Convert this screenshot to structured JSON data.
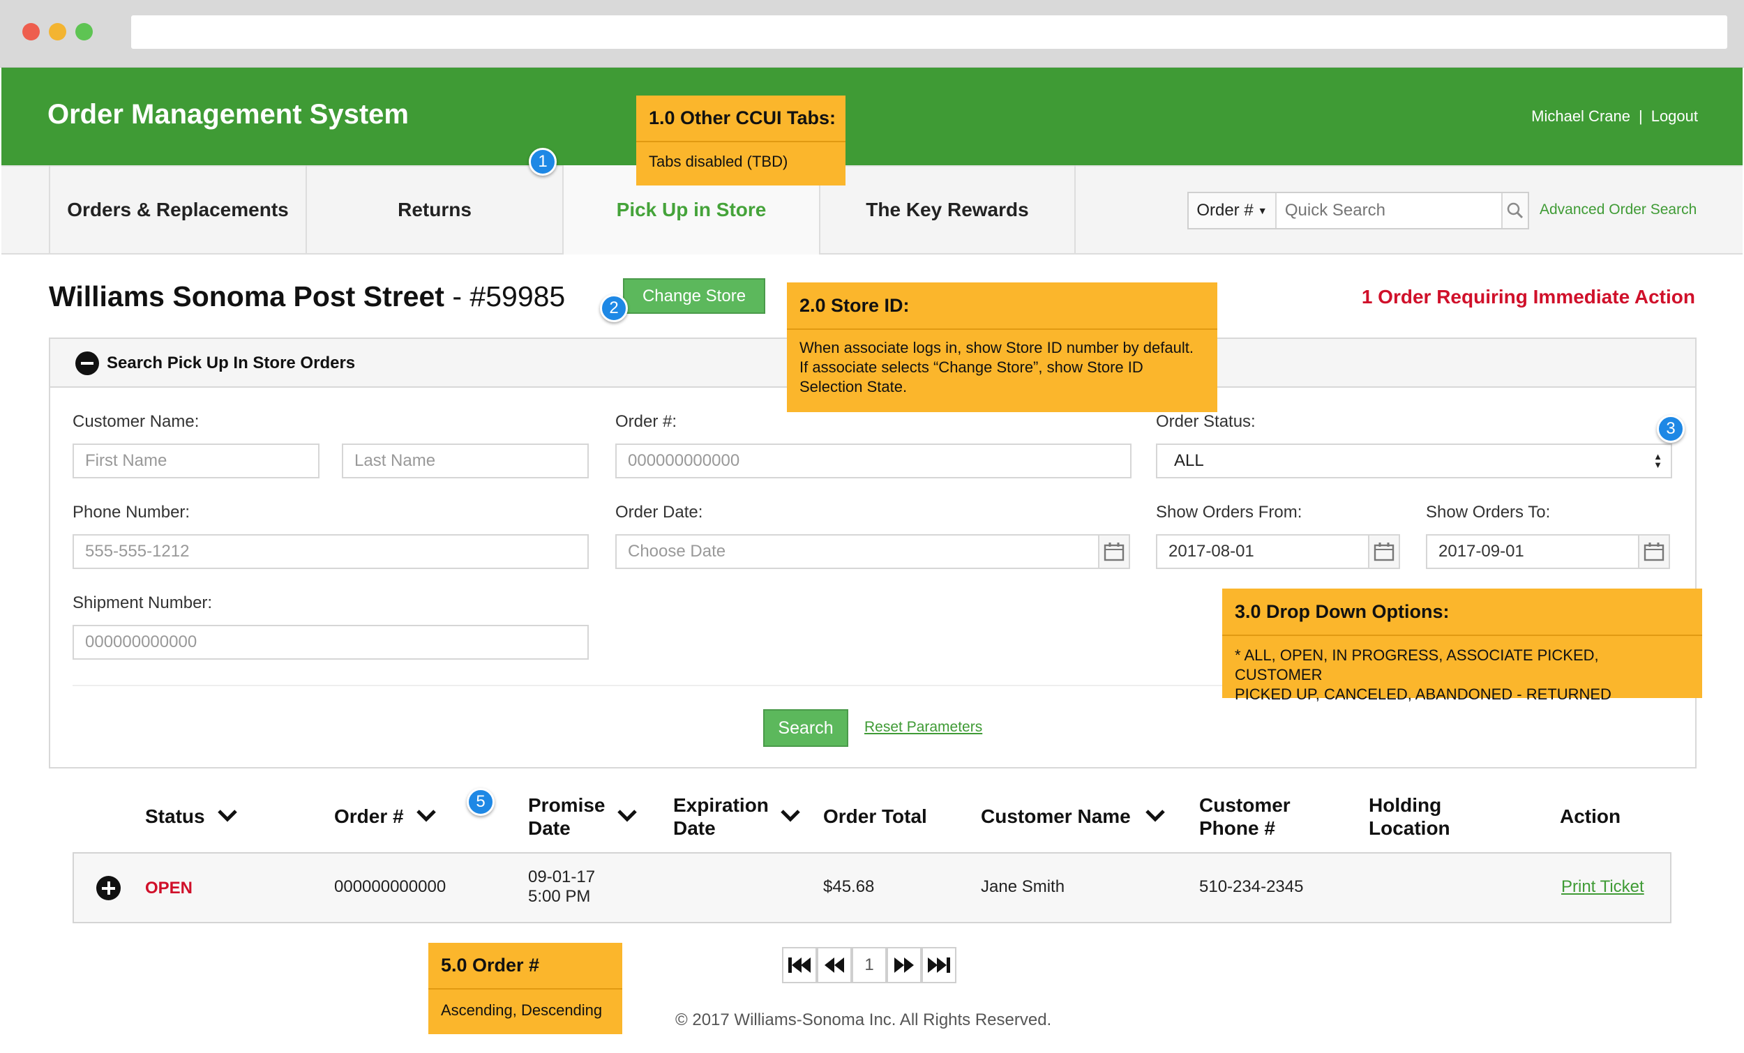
{
  "header": {
    "app_title": "Order Management System",
    "user_name": "Michael Crane",
    "separator": "|",
    "logout_label": "Logout"
  },
  "nav": {
    "tabs": [
      {
        "label": "Orders & Replacements",
        "active": false
      },
      {
        "label": "Returns",
        "active": false
      },
      {
        "label": "Pick Up in Store",
        "active": true
      },
      {
        "label": "The Key Rewards",
        "active": false
      }
    ],
    "order_type_label": "Order #",
    "quick_search_placeholder": "Quick Search",
    "advanced_search_label": "Advanced Order Search"
  },
  "store": {
    "name": "Williams Sonoma Post Street",
    "dash": "-",
    "number": "#59985",
    "change_store_label": "Change Store",
    "urgent_text": "1 Order Requiring Immediate Action"
  },
  "search_panel": {
    "title": "Search Pick Up In Store Orders",
    "customer_name_label": "Customer Name:",
    "first_name_placeholder": "First Name",
    "last_name_placeholder": "Last Name",
    "order_number_label": "Order #:",
    "order_number_placeholder": "000000000000",
    "order_status_label": "Order Status:",
    "order_status_value": "ALL",
    "phone_label": "Phone Number:",
    "phone_placeholder": "555-555-1212",
    "order_date_label": "Order Date:",
    "order_date_placeholder": "Choose Date",
    "from_label": "Show Orders From:",
    "from_value": "2017-08-01",
    "to_label": "Show Orders To:",
    "to_value": "2017-09-01",
    "shipment_label": "Shipment Number:",
    "shipment_placeholder": "000000000000",
    "search_label": "Search",
    "reset_label": "Reset Parameters"
  },
  "table": {
    "columns": [
      {
        "line1": "Status",
        "line2": ""
      },
      {
        "line1": "Order #",
        "line2": ""
      },
      {
        "line1": "Promise",
        "line2": "Date"
      },
      {
        "line1": "Expiration",
        "line2": "Date"
      },
      {
        "line1": "Order Total",
        "line2": ""
      },
      {
        "line1": "Customer Name",
        "line2": ""
      },
      {
        "line1": "Customer",
        "line2": "Phone #"
      },
      {
        "line1": "Holding",
        "line2": "Location"
      },
      {
        "line1": "Action",
        "line2": ""
      }
    ],
    "rows": [
      {
        "status": "OPEN",
        "order_number": "000000000000",
        "promise_date": "09-01-17",
        "promise_time": "5:00 PM",
        "order_total": "$45.68",
        "customer_name": "Jane Smith",
        "customer_phone": "510-234-2345",
        "action": "Print Ticket"
      }
    ]
  },
  "pagination": {
    "current_page": "1"
  },
  "footer": {
    "copyright": "© 2017 Williams-Sonoma Inc. All Rights Reserved."
  },
  "annotations": [
    {
      "badge": "1",
      "title": "1.0 Other CCUI Tabs:",
      "body": "Tabs disabled (TBD)"
    },
    {
      "badge": "2",
      "title": "2.0 Store ID:",
      "body_lines": [
        "When associate logs in, show Store ID number by default.",
        "If associate selects “Change Store”, show Store ID",
        "Selection State."
      ]
    },
    {
      "badge": "3",
      "title": "3.0 Drop Down Options:",
      "body_lines": [
        "* ALL, OPEN, IN PROGRESS, ASSOCIATE PICKED, CUSTOMER",
        "PICKED UP, CANCELED, ABANDONED - RETURNED"
      ]
    },
    {
      "badge": "5",
      "title": "5.0 Order #",
      "body": "Ascending, Descending"
    }
  ],
  "colors": {
    "header_green": "#3f9b35",
    "active_tab_green": "#45a33a",
    "button_green": "#5cb85c",
    "alert_red": "#d0102a",
    "note_orange": "#fbb62c",
    "badge_blue": "#1e88e5"
  }
}
